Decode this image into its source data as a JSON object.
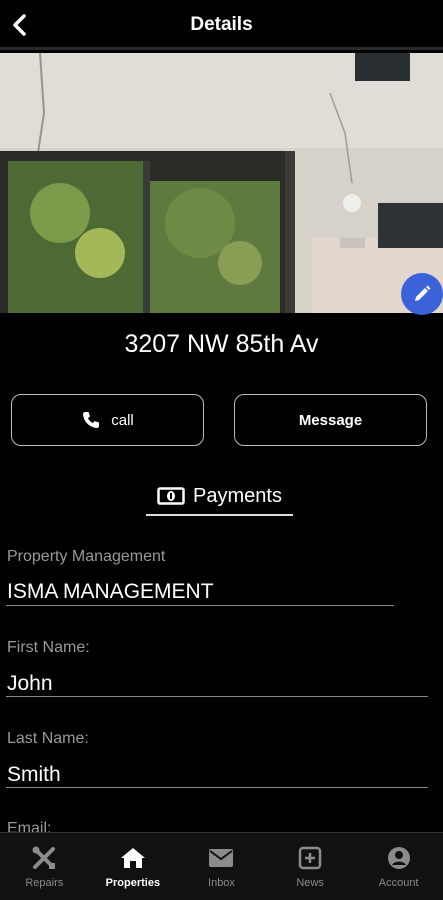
{
  "header": {
    "title": "Details",
    "back_icon": "chevron-left-icon"
  },
  "property": {
    "address": "3207 NW 85th Av",
    "edit_icon": "pencil-icon"
  },
  "actions": {
    "call_label": "call",
    "message_label": "Message"
  },
  "payments": {
    "label": "Payments",
    "icon": "money-bill-icon"
  },
  "fields": [
    {
      "label": "Property Management",
      "value": "ISMA MANAGEMENT"
    },
    {
      "label": "First Name:",
      "value": "John"
    },
    {
      "label": "Last Name:",
      "value": "Smith"
    },
    {
      "label": "Email:",
      "value": ""
    }
  ],
  "tabs": [
    {
      "label": "Repairs",
      "icon": "tools-icon",
      "active": false
    },
    {
      "label": "Properties",
      "icon": "home-icon",
      "active": true
    },
    {
      "label": "Inbox",
      "icon": "envelope-icon",
      "active": false
    },
    {
      "label": "News",
      "icon": "plus-square-icon",
      "active": false
    },
    {
      "label": "Account",
      "icon": "user-circle-icon",
      "active": false
    }
  ],
  "colors": {
    "background": "#000000",
    "fab": "#3b62d9",
    "muted_text": "#9a9a9a"
  }
}
